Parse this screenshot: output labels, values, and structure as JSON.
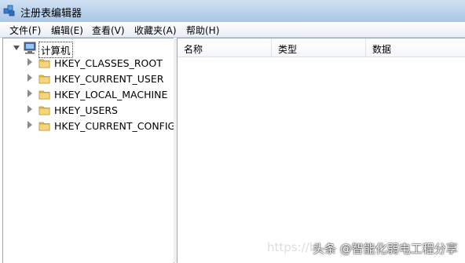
{
  "window": {
    "title": "注册表编辑器"
  },
  "menu": [
    "文件(F)",
    "编辑(E)",
    "查看(V)",
    "收藏夹(A)",
    "帮助(H)"
  ],
  "tree": {
    "root": {
      "label": "计算机",
      "icon": "computer-icon",
      "expanded": true
    },
    "children": [
      "HKEY_CLASSES_ROOT",
      "HKEY_CURRENT_USER",
      "HKEY_LOCAL_MACHINE",
      "HKEY_USERS",
      "HKEY_CURRENT_CONFIG"
    ]
  },
  "list": {
    "columns": [
      "名称",
      "类型",
      "数据"
    ]
  },
  "watermark": {
    "faint": "https://b",
    "text": "头条 @智能化弱电工程分享"
  },
  "colors": {
    "titlebar": "#b9d1ea",
    "folder": "#e8c25a",
    "border": "#9aa6b5"
  }
}
